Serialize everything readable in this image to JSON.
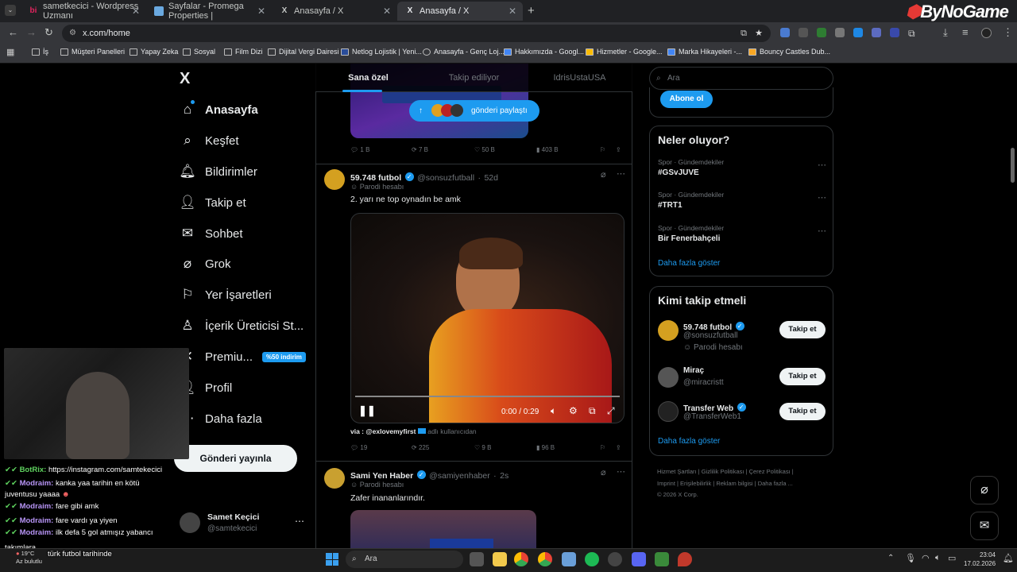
{
  "browser": {
    "tabs": [
      {
        "title": "sametkecici - Wordpress Uzmanı",
        "icon": "bi"
      },
      {
        "title": "Sayfalar - Promega Properties |",
        "icon": "folder"
      },
      {
        "title": "Anasayfa / X",
        "icon": "X"
      },
      {
        "title": "Anasayfa / X",
        "icon": "X"
      }
    ],
    "new_tab": "+",
    "url": "x.com/home",
    "bookmarks": [
      "İş",
      "Müşteri Panelleri",
      "Yapay Zeka",
      "Sosyal",
      "Film Dizi",
      "Dijital Vergi Dairesi",
      "Netlog Lojistik | Yeni...",
      "Anasayfa - Genç Loj...",
      "Hakkımızda - Googl...",
      "Hizmetler - Google...",
      "Marka Hikayeleri -...",
      "Bouncy Castles Dub..."
    ],
    "watermark": "ByNoGame"
  },
  "sidebar": {
    "logo": "X",
    "items": [
      {
        "label": "Anasayfa",
        "icon": "home-icon"
      },
      {
        "label": "Keşfet",
        "icon": "search-icon"
      },
      {
        "label": "Bildirimler",
        "icon": "bell-icon"
      },
      {
        "label": "Takip et",
        "icon": "follow-icon"
      },
      {
        "label": "Sohbet",
        "icon": "mail-icon"
      },
      {
        "label": "Grok",
        "icon": "grok-icon"
      },
      {
        "label": "Yer İşaretleri",
        "icon": "bookmark-icon"
      },
      {
        "label": "İçerik Üreticisi St...",
        "icon": "creator-icon"
      },
      {
        "label": "Premiu...",
        "icon": "x-icon"
      },
      {
        "label": "Profil",
        "icon": "user-icon"
      },
      {
        "label": "Daha fazla",
        "icon": "more-icon"
      }
    ],
    "premium_badge": "%50 indirim",
    "post_button": "Gönderi yayınla",
    "account": {
      "name": "Samet Keçici",
      "handle": "@samtekecici"
    }
  },
  "feed": {
    "tabs": [
      "Sana özel",
      "Takip ediliyor",
      "IdrisUstaUSA"
    ],
    "share_pill": "gönderi paylaştı",
    "first_post_stats": {
      "replies": "1 B",
      "reposts": "7 B",
      "likes": "50 B",
      "views": "403 B"
    },
    "posts": [
      {
        "name": "59.748 futbol",
        "handle": "@sonsuzfutball",
        "time": "52d",
        "label": "Parodi hesabı",
        "text": "2. yarı ne top oynadın be amk",
        "video_time": "0:00 / 0:29",
        "via": "via : @exlovemyfirst",
        "via_suffix": "adlı kullanıcıdan",
        "stats": {
          "replies": "19",
          "reposts": "225",
          "likes": "9 B",
          "views": "96 B"
        }
      },
      {
        "name": "Sami Yen Haber",
        "handle": "@samiyenhaber",
        "time": "2s",
        "label": "Parodi hesabı",
        "text": "Zafer inananlarındır."
      }
    ]
  },
  "right": {
    "search_placeholder": "Ara",
    "subscribe": "Abone ol",
    "trends_title": "Neler oluyor?",
    "trends": [
      {
        "cat": "Spor · Gündemdekiler",
        "name": "#GSvJUVE"
      },
      {
        "cat": "Spor · Gündemdekiler",
        "name": "#TRT1"
      },
      {
        "cat": "Spor · Gündemdekiler",
        "name": "Bir Fenerbahçeli"
      }
    ],
    "show_more": "Daha fazla göster",
    "who_title": "Kimi takip etmeli",
    "who": [
      {
        "name": "59.748 futbol",
        "handle": "@sonsuzfutball",
        "extra": "Parodi hesabı",
        "button": "Takip et"
      },
      {
        "name": "Miraç",
        "handle": "@miracristt",
        "extra": "",
        "button": "Takip et"
      },
      {
        "name": "Transfer Web",
        "handle": "@TransferWeb1",
        "extra": "",
        "button": "Takip et"
      }
    ],
    "who_more": "Daha fazla göster",
    "footer_line1": "Hizmet Şartları | Gizlilik Politikası | Çerez Politikası |",
    "footer_line2": "Imprint | Erişilebilirlik | Reklam bilgisi | Daha fazla ...",
    "footer_line3": "© 2026 X Corp."
  },
  "chat": [
    {
      "user": "BotRix:",
      "msg": "https://instagram.com/samtekecici"
    },
    {
      "user": "Modraim:",
      "msg": "kanka yaa tarihin en kötü"
    },
    {
      "user": "",
      "msg": "juventusu yaaaa"
    },
    {
      "user": "Modraim:",
      "msg": "fare gibi amk"
    },
    {
      "user": "Modraim:",
      "msg": "fare vardı ya yiyen"
    },
    {
      "user": "Modraim:",
      "msg": "ilk defa 5 gol atmışız yabancı"
    },
    {
      "user": "",
      "msg": "takımlara"
    },
    {
      "user": "",
      "msg": "türk futbol tarihinde"
    }
  ],
  "taskbar": {
    "search": "Ara",
    "time": "23:04",
    "date": "17.02.2026",
    "weather_temp": "19°C",
    "weather_desc": "Az bulutlu"
  }
}
